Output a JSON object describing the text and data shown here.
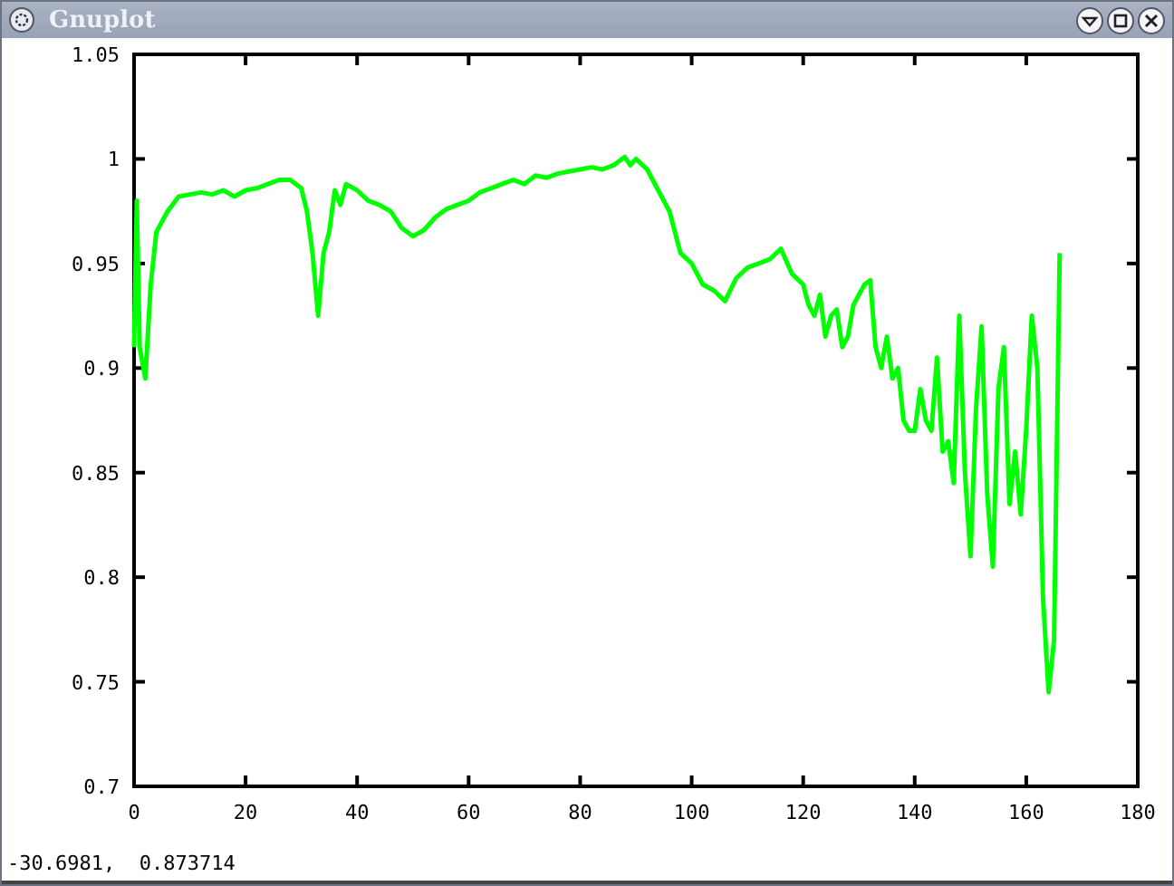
{
  "window": {
    "title": "Gnuplot"
  },
  "plot": {
    "chart_data": {
      "type": "line",
      "x": [
        0,
        0.5,
        1,
        2,
        3,
        4,
        6,
        8,
        10,
        12,
        14,
        16,
        18,
        20,
        22,
        24,
        26,
        28,
        30,
        31,
        32,
        33,
        34,
        35,
        36,
        37,
        38,
        40,
        42,
        44,
        46,
        48,
        50,
        52,
        54,
        56,
        58,
        60,
        62,
        64,
        66,
        68,
        70,
        72,
        74,
        76,
        78,
        80,
        82,
        84,
        86,
        88,
        89,
        90,
        92,
        94,
        96,
        98,
        100,
        102,
        104,
        106,
        108,
        110,
        112,
        114,
        116,
        118,
        120,
        121,
        122,
        123,
        124,
        125,
        126,
        127,
        128,
        129,
        130,
        131,
        132,
        133,
        134,
        135,
        136,
        137,
        138,
        139,
        140,
        141,
        142,
        143,
        144,
        145,
        146,
        147,
        148,
        149,
        150,
        151,
        152,
        153,
        154,
        155,
        156,
        157,
        158,
        159,
        160,
        161,
        162,
        163,
        164,
        165,
        166
      ],
      "series": [
        {
          "color": "#00ff00",
          "values": [
            0.91,
            0.98,
            0.91,
            0.895,
            0.94,
            0.965,
            0.975,
            0.982,
            0.983,
            0.984,
            0.983,
            0.985,
            0.982,
            0.985,
            0.986,
            0.988,
            0.99,
            0.99,
            0.986,
            0.975,
            0.955,
            0.925,
            0.955,
            0.965,
            0.985,
            0.978,
            0.988,
            0.985,
            0.98,
            0.978,
            0.975,
            0.967,
            0.963,
            0.966,
            0.972,
            0.976,
            0.978,
            0.98,
            0.984,
            0.986,
            0.988,
            0.99,
            0.988,
            0.992,
            0.991,
            0.993,
            0.994,
            0.995,
            0.996,
            0.995,
            0.997,
            1.001,
            0.997,
            1.0,
            0.995,
            0.985,
            0.975,
            0.955,
            0.95,
            0.94,
            0.937,
            0.932,
            0.943,
            0.948,
            0.95,
            0.952,
            0.957,
            0.945,
            0.94,
            0.93,
            0.925,
            0.935,
            0.915,
            0.925,
            0.928,
            0.91,
            0.915,
            0.93,
            0.935,
            0.94,
            0.942,
            0.91,
            0.9,
            0.915,
            0.895,
            0.9,
            0.875,
            0.87,
            0.87,
            0.89,
            0.875,
            0.87,
            0.905,
            0.86,
            0.865,
            0.845,
            0.925,
            0.85,
            0.81,
            0.88,
            0.92,
            0.84,
            0.805,
            0.89,
            0.91,
            0.835,
            0.86,
            0.83,
            0.87,
            0.925,
            0.9,
            0.79,
            0.745,
            0.77,
            0.955
          ]
        }
      ],
      "xlim": [
        0,
        180
      ],
      "ylim": [
        0.7,
        1.05
      ],
      "xticks": [
        0,
        20,
        40,
        60,
        80,
        100,
        120,
        140,
        160,
        180
      ],
      "yticks": [
        {
          "value": 0.7,
          "label": "0.7"
        },
        {
          "value": 0.75,
          "label": "0.75"
        },
        {
          "value": 0.8,
          "label": "0.8"
        },
        {
          "value": 0.85,
          "label": "0.85"
        },
        {
          "value": 0.9,
          "label": "0.9"
        },
        {
          "value": 0.95,
          "label": "0.95"
        },
        {
          "value": 1,
          "label": "1"
        },
        {
          "value": 1.05,
          "label": "1.05"
        }
      ]
    }
  },
  "status_bar": {
    "text": "-30.6981,  0.873714"
  }
}
